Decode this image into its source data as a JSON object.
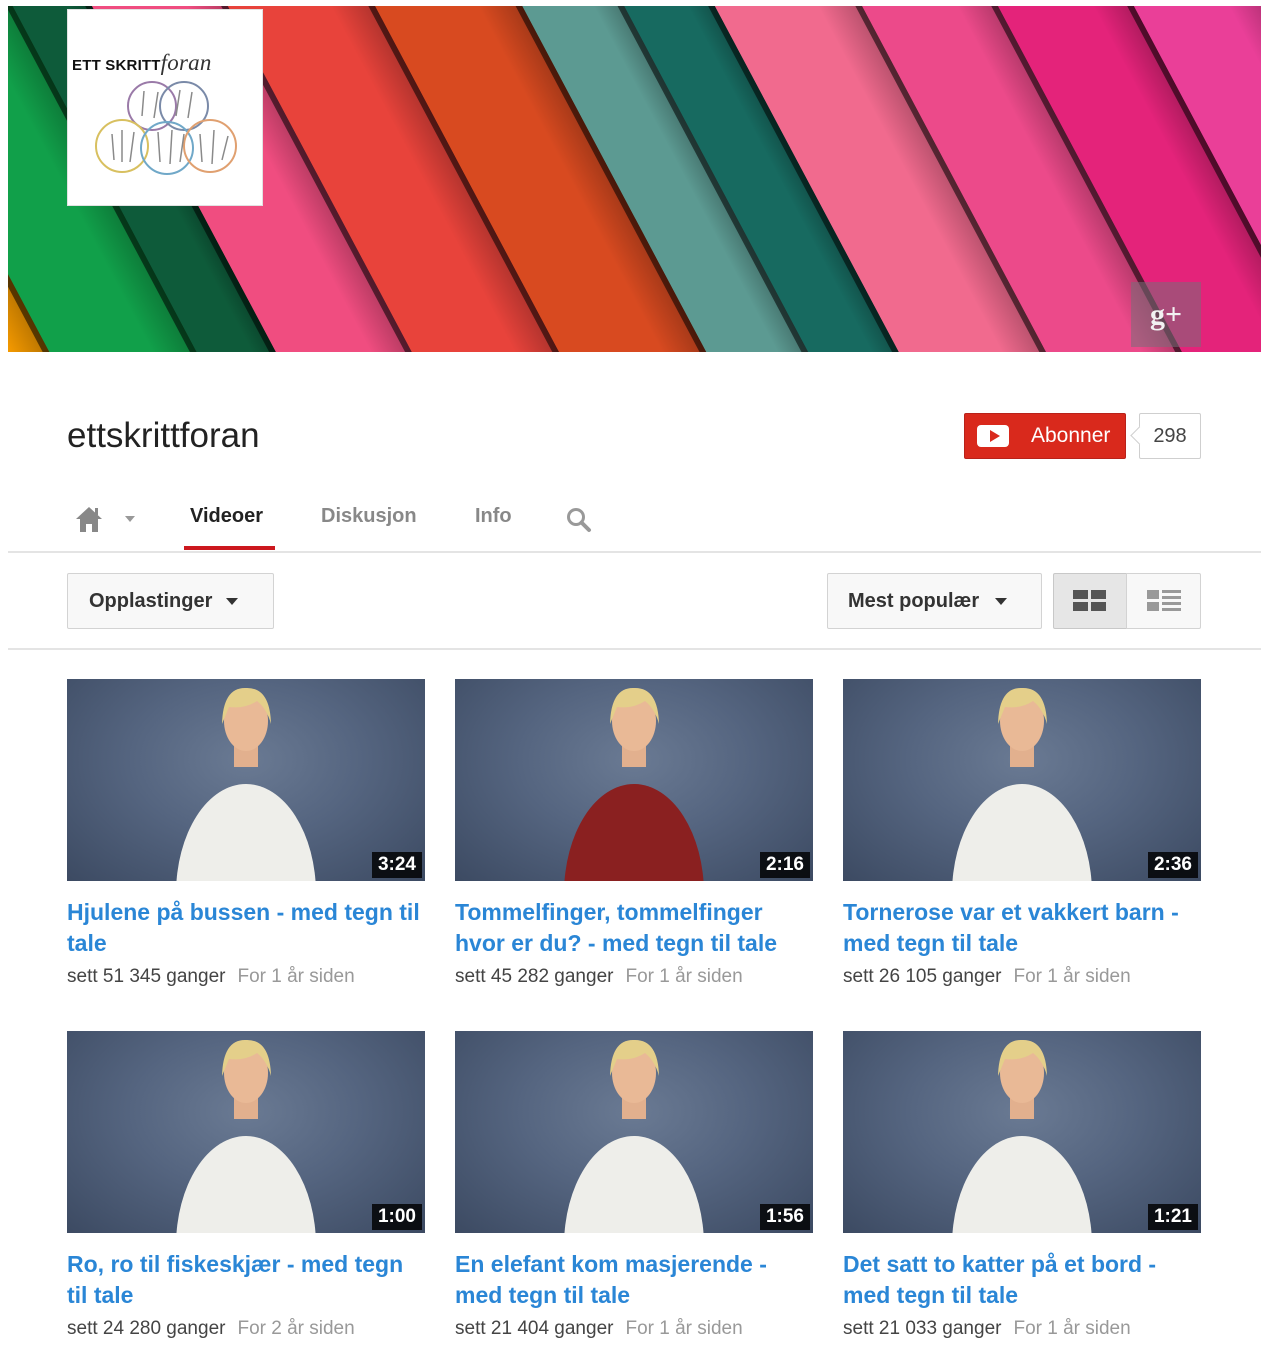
{
  "banner": {
    "logo": {
      "text": "ETT SKRITT",
      "script": "foran"
    },
    "stripe_colors": [
      "#d81e1e",
      "#f7d000",
      "#f59a00",
      "#11a04a",
      "#0e5b3a",
      "#f04d80",
      "#e8433b",
      "#d84a20",
      "#5c9a92",
      "#176a60",
      "#f16a8e",
      "#ec4a8a",
      "#e4237a",
      "#ea3f98",
      "#36b83a"
    ],
    "gplus_icon": "google-plus-icon",
    "gplus_label": "g+"
  },
  "channel": {
    "name": "ettskrittforan",
    "subscribe_label": "Abonner",
    "subscriber_count": "298"
  },
  "tabs": {
    "home_icon": "home-icon",
    "items": [
      {
        "label": "Videoer",
        "active": true
      },
      {
        "label": "Diskusjon",
        "active": false
      },
      {
        "label": "Info",
        "active": false
      }
    ],
    "search_icon": "search-icon"
  },
  "toolbar": {
    "filter_label": "Opplastinger",
    "sort_label": "Mest populær",
    "view_grid_icon": "grid-view-icon",
    "view_list_icon": "list-view-icon"
  },
  "videos": [
    {
      "title": "Hjulene på bussen - med tegn til tale",
      "duration": "3:24",
      "views": "sett 51 345 ganger",
      "age": "For 1 år siden",
      "shirt": "#eeeeea"
    },
    {
      "title": "Tommelfinger, tommelfinger hvor er du? - med tegn til tale",
      "duration": "2:16",
      "views": "sett 45 282 ganger",
      "age": "For 1 år siden",
      "shirt": "#8a2020"
    },
    {
      "title": "Tornerose var et vakkert barn - med tegn til tale",
      "duration": "2:36",
      "views": "sett 26 105 ganger",
      "age": "For 1 år siden",
      "shirt": "#eeeeea"
    },
    {
      "title": "Ro, ro til fiskeskjær - med tegn til tale",
      "duration": "1:00",
      "views": "sett 24 280 ganger",
      "age": "For 2 år siden",
      "shirt": "#eeeeea"
    },
    {
      "title": "En elefant kom masjerende - med tegn til tale",
      "duration": "1:56",
      "views": "sett 21 404 ganger",
      "age": "For 1 år siden",
      "shirt": "#eeeeea"
    },
    {
      "title": "Det satt to katter på et bord - med tegn til tale",
      "duration": "1:21",
      "views": "sett 21 033 ganger",
      "age": "For 1 år siden",
      "shirt": "#eeeeea"
    }
  ]
}
